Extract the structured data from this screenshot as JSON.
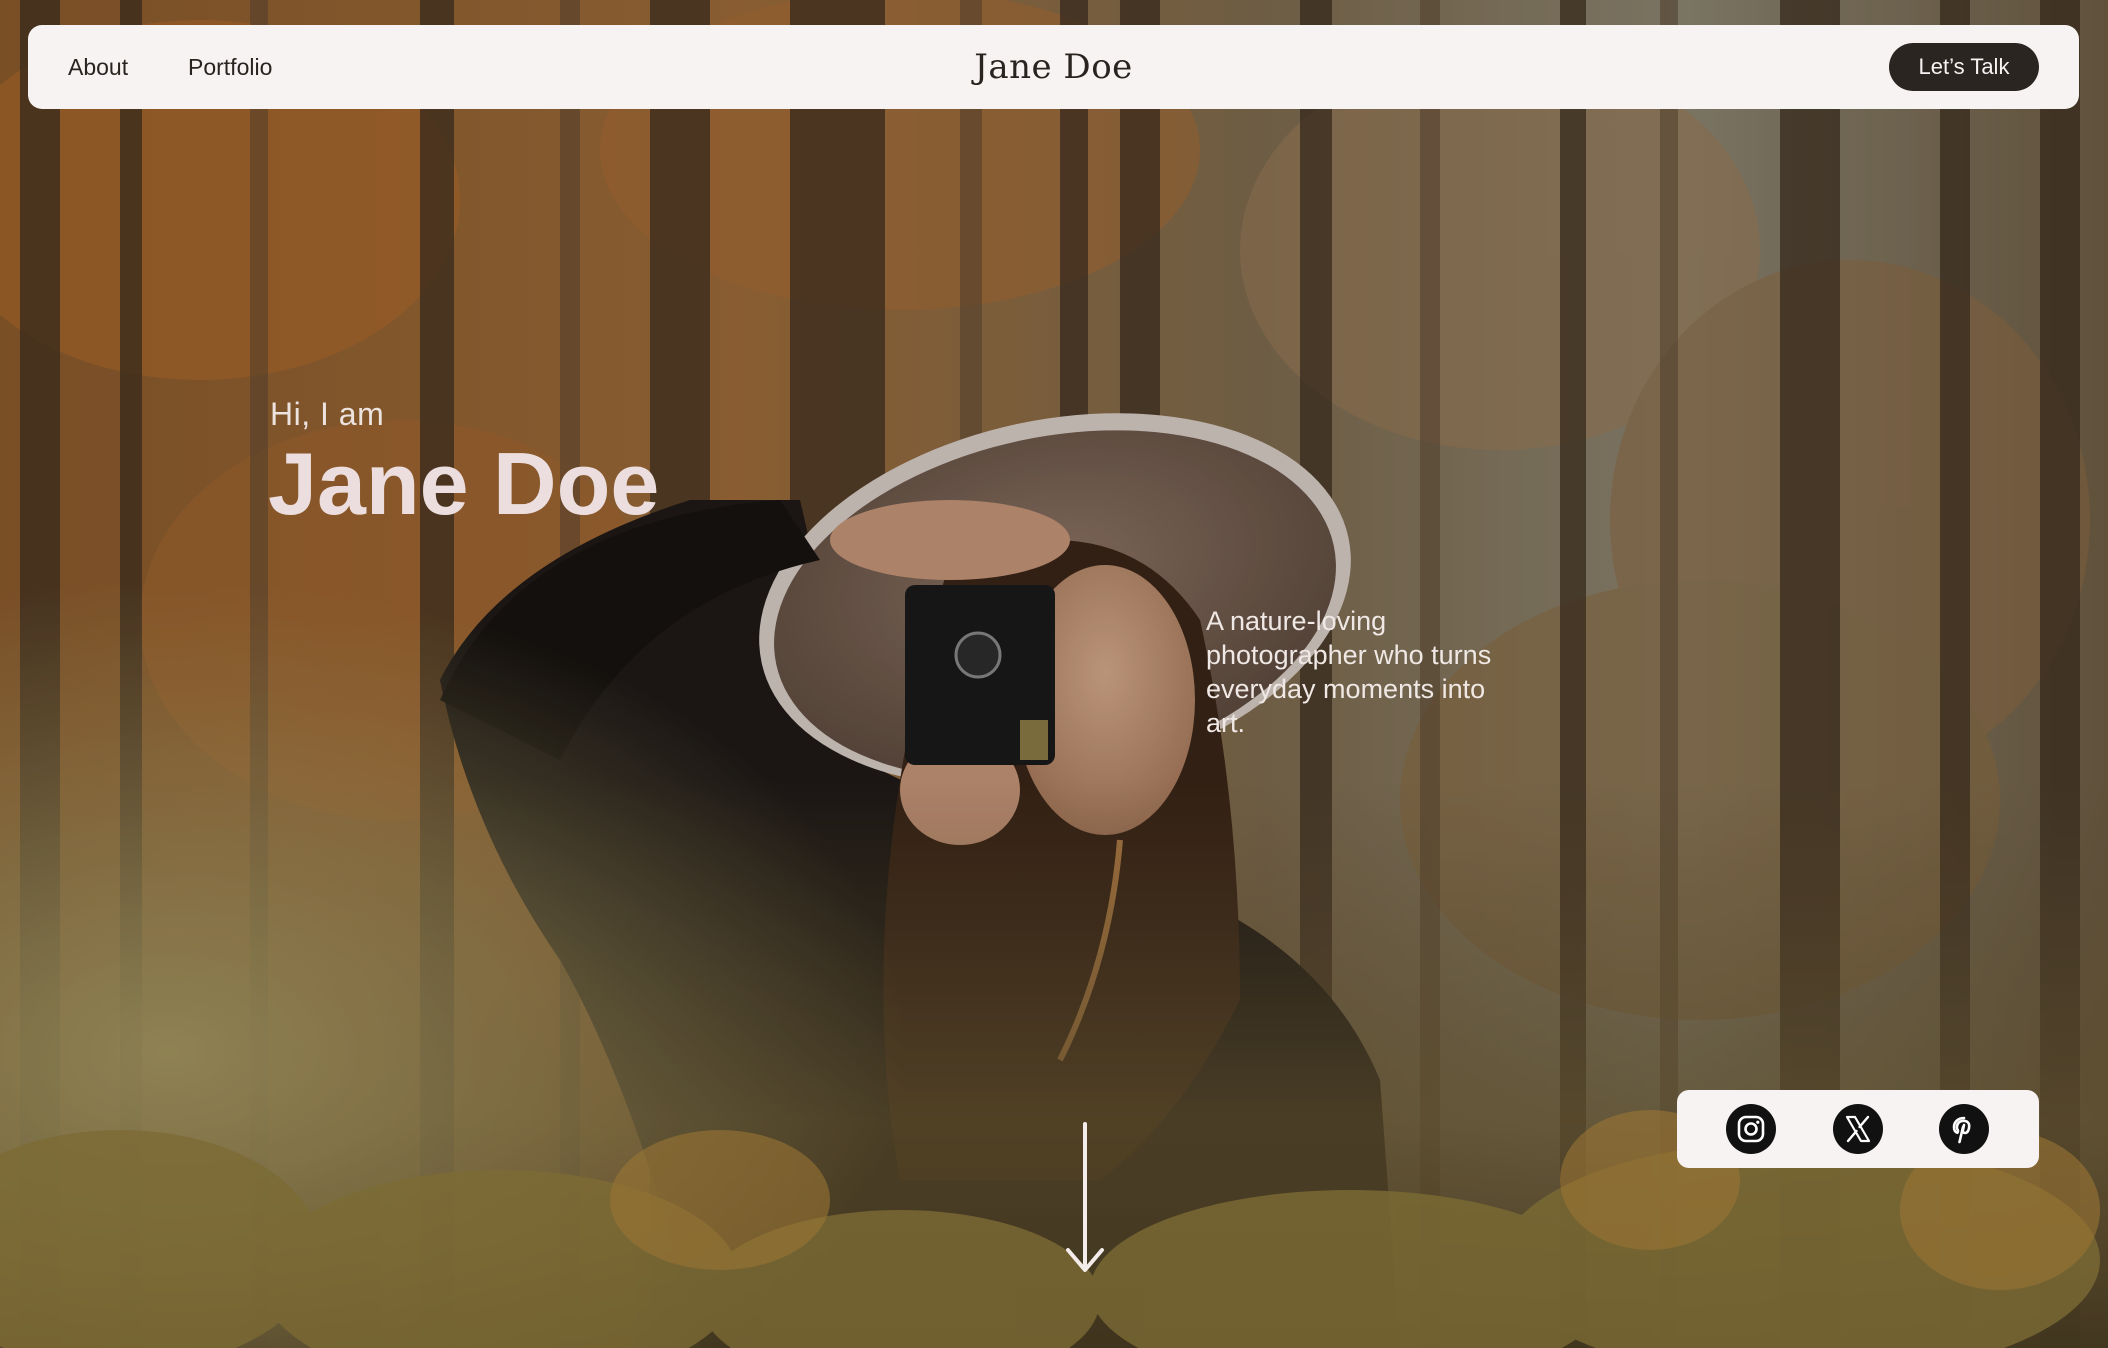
{
  "nav": {
    "about_label": "About",
    "portfolio_label": "Portfolio",
    "brand": "Jane Doe",
    "cta_label": "Let’s Talk"
  },
  "hero": {
    "greeting": "Hi, I am",
    "name": "Jane Doe",
    "tagline": "A nature-loving photographer who turns everyday moments into art."
  },
  "social": {
    "icons": [
      "instagram-icon",
      "x-icon",
      "pinterest-icon"
    ]
  },
  "colors": {
    "nav_background": "#f7f3f2",
    "button_dark": "#2b2522",
    "hero_text": "#ecdede",
    "social_icon_bg": "#111111"
  }
}
